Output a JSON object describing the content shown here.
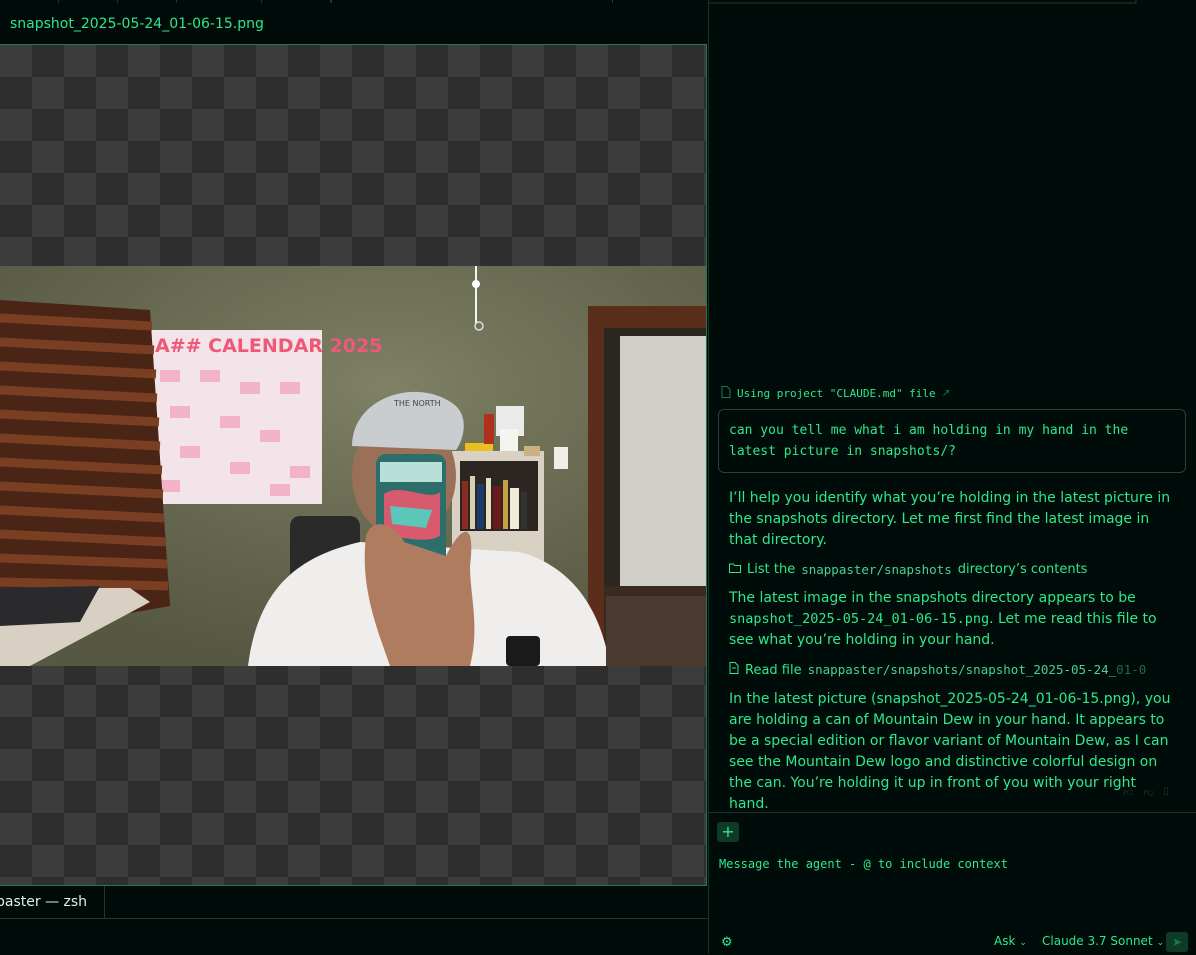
{
  "editor": {
    "file_title": "snapshot_2025-05-24_01-06-15.png"
  },
  "photo": {
    "calendar_text": "A## CALENDAR 2025"
  },
  "terminal": {
    "tab_label": "paster — zsh"
  },
  "agent": {
    "context_note": "Using project \"CLAUDE.md\" file",
    "user_message": "can you tell me what i am holding in my hand in the latest picture in snapshots/?",
    "reply_1": "I’ll help you identify what you’re holding in the latest picture in the snapshots directory. Let me first find the latest image in that directory.",
    "step_1": {
      "prefix": "List the",
      "path": "snappaster/snapshots",
      "suffix": "directory’s contents"
    },
    "reply_2_a": "The latest image in the snapshots directory appears to be",
    "reply_2_code": "snapshot_2025-05-24_01-06-15.png",
    "reply_2_b": ". Let me read this file to see what you’re holding in your hand.",
    "step_2": {
      "prefix": "Read file",
      "path": "snappaster/snapshots/snapshot_2025-05-24_",
      "path_fade": "01-0"
    },
    "reply_3": "In the latest picture (snapshot_2025-05-24_01-06-15.png), you are holding a can of Mountain Dew in your hand. It appears to be a special edition or flavor variant of Mountain Dew, as I can see the Mountain Dew logo and distinctive colorful design on the can. You’re holding it up in front of you with your right hand."
  },
  "composer": {
    "add_label": "+",
    "placeholder": "Message the agent - @ to include context",
    "mode": "Ask",
    "model": "Claude 3.7 Sonnet"
  },
  "icons": [
    "file-icon",
    "external-link-icon",
    "folder-icon",
    "file-read-icon",
    "thumbs-up-icon",
    "thumbs-down-icon",
    "copy-icon",
    "plus-icon",
    "settings-icon",
    "chevron-down-icon",
    "send-icon"
  ]
}
